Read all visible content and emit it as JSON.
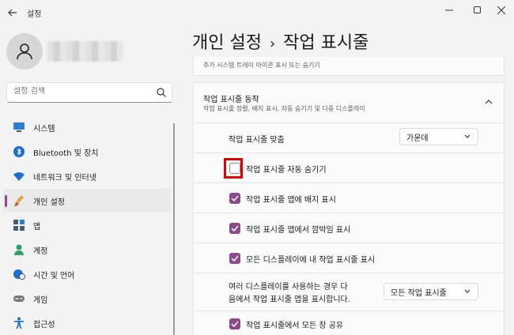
{
  "window": {
    "title": "설정",
    "controls": [
      "minimize",
      "maximize",
      "close"
    ]
  },
  "search": {
    "placeholder": "설정 검색"
  },
  "sidebar": {
    "items": [
      {
        "label": "시스템",
        "icon": "monitor-icon",
        "color": "#2b7cd3"
      },
      {
        "label": "Bluetooth 및 장치",
        "icon": "bluetooth-icon",
        "color": "#1a6fd1"
      },
      {
        "label": "네트워크 및 인터넷",
        "icon": "wifi-icon",
        "color": "#1a6fd1"
      },
      {
        "label": "개인 설정",
        "icon": "brush-icon",
        "color": "#c0663a",
        "active": true
      },
      {
        "label": "앱",
        "icon": "apps-icon",
        "color": "#4a5a70"
      },
      {
        "label": "계정",
        "icon": "person-icon",
        "color": "#2e9e6e"
      },
      {
        "label": "시간 및 언어",
        "icon": "globe-clock-icon",
        "color": "#1a6fd1"
      },
      {
        "label": "게임",
        "icon": "gamepad-icon",
        "color": "#6b6b6b"
      },
      {
        "label": "접근성",
        "icon": "accessibility-icon",
        "color": "#1a6fd1"
      }
    ]
  },
  "header": {
    "parent": "개인 설정",
    "separator": "›",
    "current": "작업 표시줄"
  },
  "content": {
    "top_item": "추가 시스템 트레이 아이콘 표시 또는 숨기기",
    "section": {
      "title": "작업 표시줄 동작",
      "subtitle": "작업 표시줄 정렬, 배지 표시, 자동 숨기기 및 다중 디스플레이"
    },
    "alignment": {
      "label": "작업 표시줄 맞춤",
      "value": "가운데"
    },
    "options": [
      {
        "label": "작업 표시줄 자동 숨기기",
        "checked": false
      },
      {
        "label": "작업 표시줄 앱에 배지 표시",
        "checked": true
      },
      {
        "label": "작업 표시줄 앱에서 깜박임 표시",
        "checked": true
      },
      {
        "label": "모든 디스플레이에 내 작업 표시줄 표시",
        "checked": true
      }
    ],
    "multi_display": {
      "label_line1": "여러 디스플레이를 사용하는 경우 다",
      "label_line2": "음에서 작업 표시줄 앱을 표시합니다.",
      "value": "모든 작업 표시줄"
    },
    "share_any_window": {
      "label": "작업 표시줄에서 모든 창 공유",
      "checked": true
    }
  },
  "colors": {
    "accent": "#8a4a8c",
    "highlight": "#e00000"
  }
}
